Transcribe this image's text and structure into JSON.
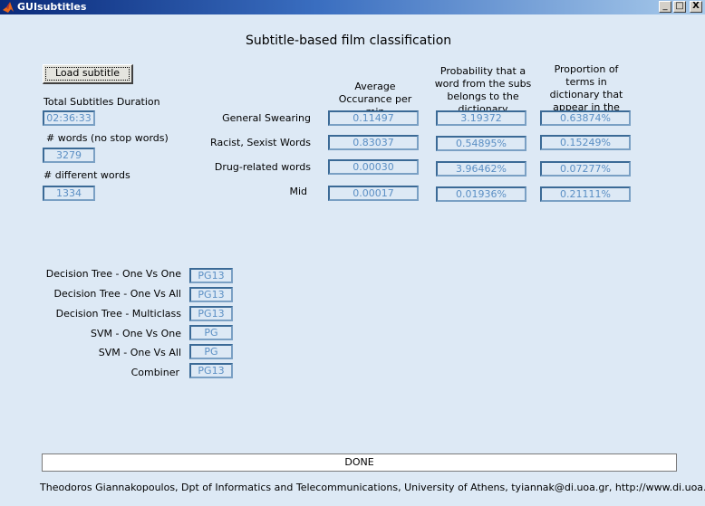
{
  "window": {
    "title": "GUIsubtitles",
    "minimize": "_",
    "maximize": "□",
    "close": "X"
  },
  "header": {
    "title": "Subtitle-based film classification"
  },
  "load_button": {
    "label": "Load subtitle"
  },
  "stats": {
    "duration_label": "Total Subtitles Duration",
    "duration_value": "02:36:33",
    "words_label": "# words (no stop words)",
    "words_value": "3279",
    "different_label": "# different words",
    "different_value": "1334"
  },
  "columns": [
    "Average Occurance per min",
    "Probability that a word from the subs belongs to the dictionary",
    "Proportion of terms in dictionary that appear in the subs"
  ],
  "rows": [
    {
      "label": "General Swearing",
      "values": [
        "0.11497",
        "3.19372",
        "0.63874%"
      ]
    },
    {
      "label": "Racist, Sexist Words",
      "values": [
        "0.83037",
        "0.54895%",
        "0.15249%"
      ]
    },
    {
      "label": "Drug-related words",
      "values": [
        "0.00030",
        "3.96462%",
        "0.07277%"
      ]
    },
    {
      "label": "Mid",
      "values": [
        "0.00017",
        "0.01936%",
        "0.21111%"
      ]
    }
  ],
  "classifiers": [
    {
      "label": "Decision Tree - One Vs One",
      "value": "PG13"
    },
    {
      "label": "Decision Tree - One Vs All",
      "value": "PG13"
    },
    {
      "label": "Decision Tree - Multiclass",
      "value": "PG13"
    },
    {
      "label": "SVM - One Vs One",
      "value": "PG"
    },
    {
      "label": "SVM - One Vs All",
      "value": "PG"
    },
    {
      "label": "Combiner",
      "value": "PG13"
    }
  ],
  "status": {
    "text": "DONE"
  },
  "footer": {
    "text": "Theodoros Giannakopoulos, Dpt of Informatics and Telecommunications, University of Athens, tyiannak@di.uoa.gr, http://www.di.uoa.gr/~tyiannak"
  },
  "icons": {
    "app": "matlab-logo-icon"
  }
}
